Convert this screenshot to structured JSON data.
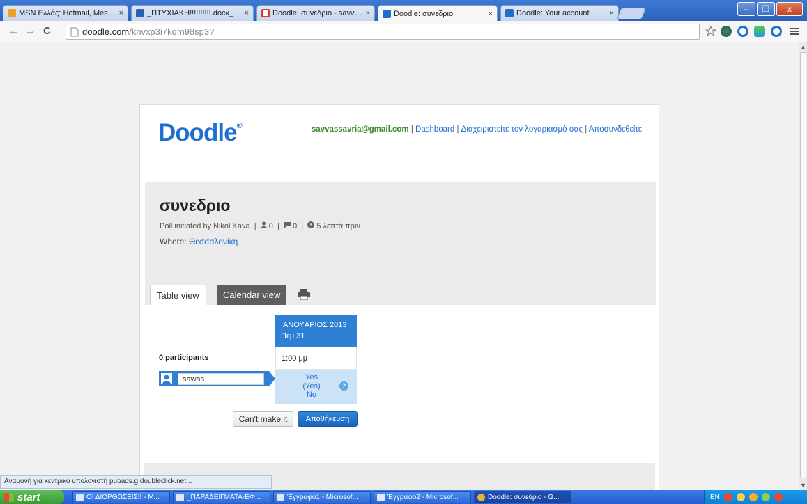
{
  "browser": {
    "tabs": [
      {
        "title": "MSN Ελλάς: Hotmail, Messen",
        "icon": "msn-butterfly-icon",
        "color": "#f0a020"
      },
      {
        "title": "_ΠΤΥΧΙΑΚΗ!!!!!!!!!!.docx_",
        "icon": "word-doc-icon",
        "color": "#2b5fb4"
      },
      {
        "title": "Doodle: συνεδριο - savvassa",
        "icon": "gmail-icon",
        "color": "#d93a2b"
      },
      {
        "title": "Doodle: συνεδριο",
        "icon": "doodle-icon",
        "color": "#1e6fcf"
      },
      {
        "title": "Doodle: Your account",
        "icon": "doodle-icon",
        "color": "#1e6fcf"
      }
    ],
    "close_glyph": "×",
    "window_controls": {
      "minimize": "–",
      "maximize": "❐",
      "close": "x"
    },
    "nav": {
      "back": "←",
      "forward": "→",
      "reload": "C"
    },
    "address": {
      "host": "doodle.com",
      "path": "/knvxp3i7kqm98sp3?"
    },
    "toolbar_icons": [
      "star-icon",
      "globe-icon",
      "extension-icon",
      "skype-icon",
      "extension-icon",
      "menu-icon"
    ]
  },
  "page": {
    "logo": "Doodle",
    "logo_mark": "®",
    "account": {
      "email": "savvassavria@gmail.com",
      "sep": " | ",
      "links": [
        "Dashboard",
        "Διαχειριστείτε τον λογαριασμό σας",
        "Αποσυνδεθείτε"
      ]
    },
    "poll": {
      "title": "συνεδριο",
      "initiated": "Poll initiated by Nikol Kava",
      "participants_count": "0",
      "comments_count": "0",
      "time_ago": "5 λεπτά πριν",
      "where_label": "Where:",
      "where_value": "Θεσσαλονίκη"
    },
    "view_tabs": {
      "table": "Table view",
      "calendar": "Calendar view"
    },
    "table": {
      "month": "ΙΑΝΟΥΆΡΙΟΣ 2013",
      "day": "Πεμ 31",
      "time": "1:00 μμ",
      "participants_label": "0 participants",
      "name_value": "sawas",
      "choice_yes": "Yes",
      "choice_maybe": "(Yes)",
      "choice_no": "No",
      "help": "?"
    },
    "buttons": {
      "cant": "Can't make it",
      "save": "Αποθήκευση"
    }
  },
  "status_text": "Αναμονή για κεντρικό υπολογιστή pubads.g.doubleclick.net...",
  "taskbar": {
    "start": "start",
    "items": [
      "ΟΙ ΔΙΟΡΘΩΣΕΙΣ!! - Μ...",
      "_ΠΑΡΑΔΕΙΓΜΑΤΑ-ΕΦ...",
      "Έγγραφο1 - Microsof...",
      "Έγγραφο2 - Microsof...",
      "Doodle: συνεδριο - G..."
    ],
    "lang": "EN"
  },
  "colors": {
    "doodle_blue": "#1e6fcf",
    "email_green": "#3b8a2a",
    "choice_bg": "#cbe2f7"
  }
}
